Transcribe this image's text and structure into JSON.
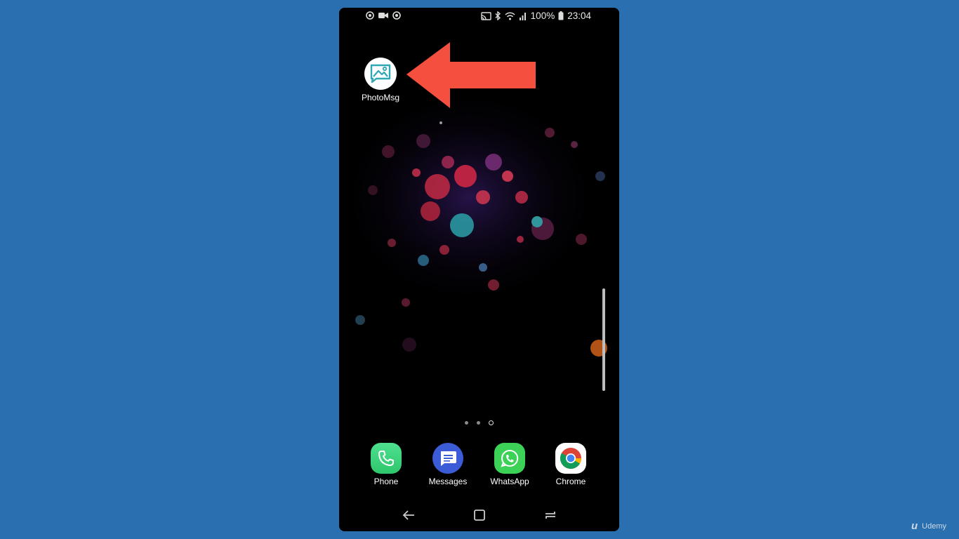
{
  "status_bar": {
    "battery": "100%",
    "time": "23:04"
  },
  "home_shortcut": {
    "label": "PhotoMsg"
  },
  "dock": [
    {
      "label": "Phone",
      "color": "#3ddc84"
    },
    {
      "label": "Messages",
      "color": "#3c5bd6"
    },
    {
      "label": "WhatsApp",
      "color": "#3cd257"
    },
    {
      "label": "Chrome",
      "color": "#ffffff"
    }
  ],
  "page_indicator": {
    "pages": 3,
    "current": 3
  },
  "annotation": {
    "arrow_color": "#f44f3f"
  },
  "watermark": {
    "brand": "Udemy"
  }
}
